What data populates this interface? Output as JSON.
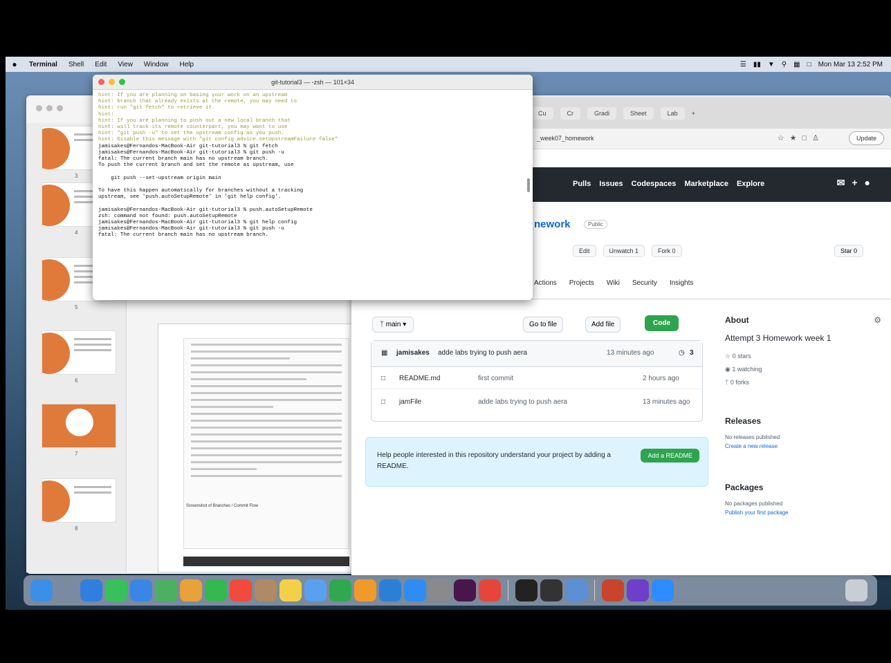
{
  "menubar": {
    "apple": "",
    "items": [
      "Terminal",
      "Shell",
      "Edit",
      "View",
      "Window",
      "Help"
    ],
    "clock": "Mon Mar 13 2:52 PM"
  },
  "terminal": {
    "title": "git-tutorial3 — -zsh — 101×34",
    "lines": [
      {
        "t": "hint: If you are planning on basing your work on an upstream",
        "hint": true
      },
      {
        "t": "hint: branch that already exists at the remote, you may need to",
        "hint": true
      },
      {
        "t": "hint: run \"git fetch\" to retrieve it.",
        "hint": true
      },
      {
        "t": "hint:",
        "hint": true
      },
      {
        "t": "hint: If you are planning to push out a new local branch that",
        "hint": true
      },
      {
        "t": "hint: will track its remote counterpart, you may want to use",
        "hint": true
      },
      {
        "t": "hint: \"git push -u\" to set the upstream config as you push.",
        "hint": true
      },
      {
        "t": "hint: Disable this message with \"git config advice.setUpstreamFailure false\"",
        "hint": true
      },
      {
        "t": "jamisakes@Fernandos-MacBook-Air git-tutorial3 % git fetch",
        "hint": false
      },
      {
        "t": "jamisakes@Fernandos-MacBook-Air git-tutorial3 % git push -u",
        "hint": false
      },
      {
        "t": "fatal: The current branch main has no upstream branch.",
        "hint": false
      },
      {
        "t": "To push the current branch and set the remote as upstream, use",
        "hint": false
      },
      {
        "t": "",
        "hint": false
      },
      {
        "t": "    git push --set-upstream origin main",
        "hint": false
      },
      {
        "t": "",
        "hint": false
      },
      {
        "t": "To have this happen automatically for branches without a tracking",
        "hint": false
      },
      {
        "t": "upstream, see 'push.autoSetupRemote' in 'git help config'.",
        "hint": false
      },
      {
        "t": "",
        "hint": false
      },
      {
        "t": "jamisakes@Fernandos-MacBook-Air git-tutorial3 % push.autoSetupRemote",
        "hint": false
      },
      {
        "t": "zsh: command not found: push.autoSetupRemote",
        "hint": false
      },
      {
        "t": "jamisakes@Fernandos-MacBook-Air git-tutorial3 % git help config",
        "hint": false
      },
      {
        "t": "jamisakes@Fernandos-MacBook-Air git-tutorial3 % git push -u",
        "hint": false
      },
      {
        "t": "fatal: The current branch main has no upstream branch.",
        "hint": false
      }
    ]
  },
  "browser": {
    "url": "_week07_homework",
    "profile_button": "Update",
    "tabs": [
      "Cu",
      "Cr",
      "Gradi",
      "Sheet",
      "Lab"
    ]
  },
  "github": {
    "nav": [
      "Pulls",
      "Issues",
      "Codespaces",
      "Marketplace",
      "Explore"
    ],
    "repo_name": "nework",
    "visibility": "Public",
    "repo_actions": [
      "Edit",
      "Unwatch 1",
      "Fork 0"
    ],
    "star": "Star 0",
    "tabs": [
      "Actions",
      "Projects",
      "Wiki",
      "Security",
      "Insights"
    ],
    "branch": "main",
    "go_to_file": "Go to file",
    "add_file": "Add file",
    "code_button": "Code",
    "commit": {
      "author": "jamisakes",
      "message": "adde labs trying to push aera",
      "time": "13 minutes ago",
      "count": "3"
    },
    "files": [
      {
        "name": "README.md",
        "message": "first commit",
        "time": "2 hours ago"
      },
      {
        "name": "jamFile",
        "message": "adde labs trying to push aera",
        "time": "13 minutes ago"
      }
    ],
    "readme_prompt": "Help people interested in this repository understand your project by adding a README.",
    "readme_button": "Add a README",
    "about": {
      "title": "About",
      "description": "Attempt 3 Homework week 1",
      "stars": "0 stars",
      "watching": "1 watching",
      "forks": "0 forks"
    },
    "releases": {
      "title": "Releases",
      "none": "No releases published",
      "create": "Create a new release"
    },
    "packages": {
      "title": "Packages",
      "none": "No packages published",
      "publish": "Publish your first package"
    }
  },
  "keynote": {
    "slide_numbers": [
      "3",
      "4",
      "5",
      "6",
      "7",
      "8"
    ],
    "doc_caption": "Screenshot of Branches / Commit Flow"
  },
  "dock": {
    "apps": [
      {
        "name": "finder",
        "color": "#3b8fe8"
      },
      {
        "name": "launchpad",
        "color": "#7a8aa0"
      },
      {
        "name": "safari",
        "color": "#2f7fe0"
      },
      {
        "name": "messages",
        "color": "#38c15a"
      },
      {
        "name": "mail",
        "color": "#3a86e6"
      },
      {
        "name": "maps",
        "color": "#4bb060"
      },
      {
        "name": "photos",
        "color": "#e8a23a"
      },
      {
        "name": "facetime",
        "color": "#34b84f"
      },
      {
        "name": "calendar",
        "color": "#f24a3c"
      },
      {
        "name": "contacts",
        "color": "#b08a64"
      },
      {
        "name": "notes",
        "color": "#f4d04a"
      },
      {
        "name": "reminders",
        "color": "#5aa0f0"
      },
      {
        "name": "numbers",
        "color": "#2fa84f"
      },
      {
        "name": "pages",
        "color": "#f09a2a"
      },
      {
        "name": "keynote",
        "color": "#2c7fd6"
      },
      {
        "name": "app-store",
        "color": "#2f8cf2"
      },
      {
        "name": "settings",
        "color": "#8a8a8a"
      },
      {
        "name": "slack",
        "color": "#4a154b"
      },
      {
        "name": "chrome",
        "color": "#e6463a"
      },
      {
        "name": "terminal",
        "color": "#222222"
      },
      {
        "name": "terminal-2",
        "color": "#333333"
      },
      {
        "name": "preview",
        "color": "#5b8fd6"
      },
      {
        "name": "powerpoint",
        "color": "#c8452c"
      },
      {
        "name": "github-desktop",
        "color": "#6e3fc8"
      },
      {
        "name": "zoom",
        "color": "#2d8cff"
      }
    ],
    "trash": "trash"
  }
}
